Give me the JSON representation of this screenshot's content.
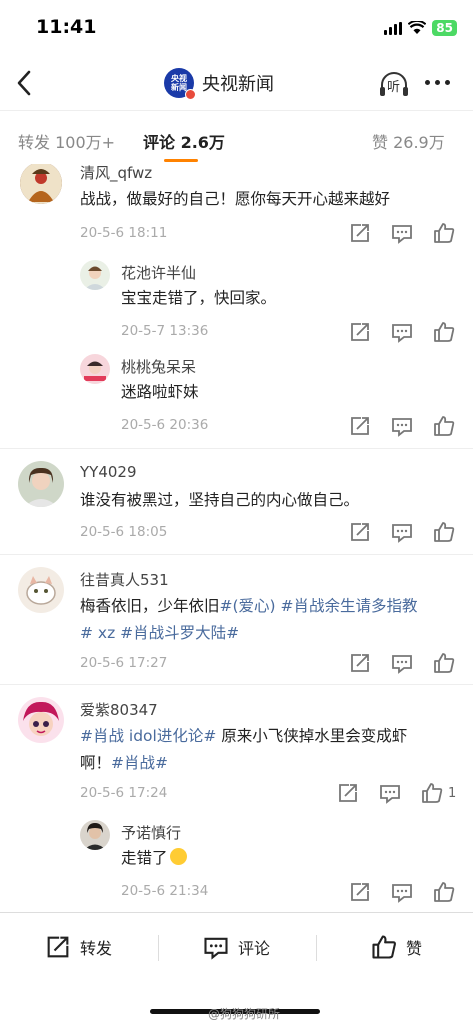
{
  "status": {
    "time": "11:41",
    "battery": "85"
  },
  "nav": {
    "title": "央视新闻",
    "avatar_text": "央视新闻",
    "listen_label": "听"
  },
  "tabs": [
    {
      "label": "转发 100万+"
    },
    {
      "label": "评论 2.6万"
    },
    {
      "label": "赞 26.9万"
    }
  ],
  "comments": [
    {
      "user": "清风_qfwz",
      "text_lines": [
        "战战，做最好的自己！愿你每天开心越来越好"
      ],
      "time": "20-5-6 18:11",
      "replies": [
        {
          "user": "花池许半仙",
          "text": "宝宝走错了，快回家。",
          "time": "20-5-7 13:36"
        },
        {
          "user": "桃桃兔呆呆",
          "text": "迷路啦虾妹",
          "time": "20-5-6 20:36"
        }
      ]
    },
    {
      "user": "YY4029",
      "text_lines": [
        "谁没有被黑过，坚持自己的内心做自己。"
      ],
      "time": "20-5-6 18:05"
    },
    {
      "user": "往昔真人531",
      "line1_plain": "梅香依旧，少年依旧",
      "line1_tag1": "#(爱心) #肖战余生请多指教",
      "line2_tag": "# xz #肖战斗罗大陆#",
      "time": "20-5-6 17:27"
    },
    {
      "user": "爱紫80347",
      "line1_tag": "#肖战 idol进化论#",
      "line1_plain": " 原来小飞侠掉水里会变成虾",
      "line2_plain": "啊！",
      "line2_tag": "#肖战#",
      "time": "20-5-6 17:24",
      "like_count": "1",
      "replies": [
        {
          "user": "予诺慎行",
          "text": "走错了",
          "time": "20-5-6 21:34"
        }
      ]
    }
  ],
  "bottom": {
    "repost": "转发",
    "comment": "评论",
    "like": "赞",
    "watermark": "@狗狗狗研所"
  },
  "colors": {
    "accent": "#ff8200",
    "tag": "#4a6b9d",
    "battery": "#4cd964"
  }
}
